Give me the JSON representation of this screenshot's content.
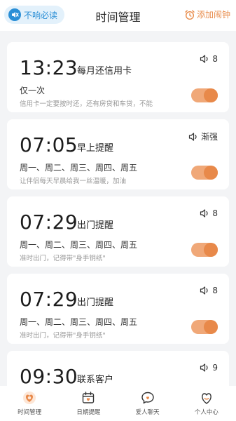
{
  "header": {
    "silent_label": "不响必读",
    "title": "时间管理",
    "add_label": "添加闹钟"
  },
  "alarms": [
    {
      "time": "13:23",
      "title": "每月还信用卡",
      "repeat": "仅一次",
      "note": "信用卡一定要按时还，还有房贷和车贷，不能",
      "volume": "8",
      "enabled": true
    },
    {
      "time": "07:05",
      "title": "早上提醒",
      "repeat": "周一、周二、周三、周四、周五",
      "note": "让伴侣每天早晨给我一丝温暖，加油",
      "volume": "渐强",
      "enabled": true
    },
    {
      "time": "07:29",
      "title": "出门提醒",
      "repeat": "周一、周二、周三、周四、周五",
      "note": "准时出门，记得带\"身手钥纸\"",
      "volume": "8",
      "enabled": true
    },
    {
      "time": "07:29",
      "title": "出门提醒",
      "repeat": "周一、周二、周三、周四、周五",
      "note": "准时出门，记得带\"身手钥纸\"",
      "volume": "8",
      "enabled": true
    },
    {
      "time": "09:30",
      "title": "联系客户",
      "volume": "9"
    }
  ],
  "nav": {
    "items": [
      {
        "label": "时间管理",
        "icon": "clock-heart-icon",
        "active": true
      },
      {
        "label": "日期提醒",
        "icon": "calendar-icon",
        "active": false
      },
      {
        "label": "爱人聊天",
        "icon": "chat-heart-icon",
        "active": false
      },
      {
        "label": "个人中心",
        "icon": "profile-heart-icon",
        "active": false
      }
    ]
  },
  "colors": {
    "accent": "#e8894a",
    "toggle_track": "#f0a878",
    "silent_bg": "#e3f1fb",
    "silent_text": "#2b8fd6",
    "background": "#f3f4f6"
  }
}
